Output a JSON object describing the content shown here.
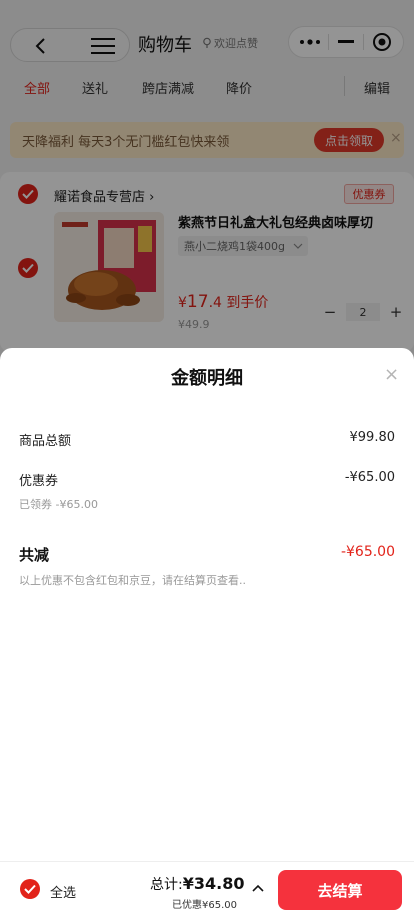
{
  "header": {
    "title": "购物车",
    "welcome": "欢迎点赞",
    "back_icon": "chevron-left-icon",
    "menu_icon": "hamburger-icon",
    "more_icon": "more-dots-icon",
    "minimize_icon": "minus-icon",
    "close_icon": "target-icon"
  },
  "tabs": {
    "all": "全部",
    "gift": "送礼",
    "cross_store": "跨店满减",
    "price_drop": "降价",
    "edit": "编辑"
  },
  "banner": {
    "text": "天降福利 每天3个无门槛红包快来领",
    "button": "点击领取",
    "close": "×"
  },
  "store": {
    "name": "耀诺食品专营店",
    "arrow": "›",
    "coupon_tag": "优惠券",
    "product": {
      "title": "紫燕节日礼盒大礼包经典卤味厚切",
      "spec": "燕小二烧鸡1袋400g",
      "price_symbol": "¥",
      "price_int": "17",
      "price_dec": ".4",
      "price_note": "到手价",
      "original_price": "¥49.9",
      "quantity": "2",
      "minus": "−",
      "plus": "+"
    }
  },
  "sheet": {
    "title": "金额明细",
    "close": "×",
    "rows": [
      {
        "label": "商品总额",
        "value": "¥99.80"
      },
      {
        "label": "优惠券",
        "value": "-¥65.00",
        "sub": "已领券 -¥65.00"
      }
    ],
    "total_label": "共减",
    "total_value": "-¥65.00",
    "note": "以上优惠不包含红包和京豆，请在结算页查看.."
  },
  "footer": {
    "select_all": "全选",
    "total_prefix": "总计:",
    "total_amount": "¥34.80",
    "discount": "已优惠¥65.00",
    "checkout": "去结算"
  },
  "colors": {
    "accent": "#e2231a",
    "checkout": "#f5323d",
    "banner_bg": "#fbe8c7"
  }
}
